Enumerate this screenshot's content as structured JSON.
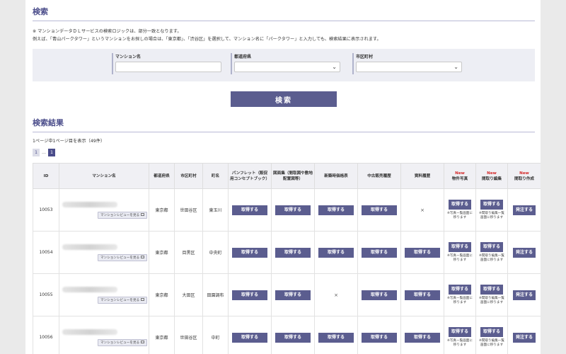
{
  "search": {
    "title": "検索",
    "notes": [
      "※ マンションデータＤＬサービスの検索ロジックは、部分一致となります。",
      "例えば、「青山パークタワー」というマンションをお探しの場合は、「東京都」、「渋谷区」を選択して、マンション名に「パークタワー」と入力しても、検索結果に表示されます。"
    ],
    "fields": {
      "mansion_label": "マンション名",
      "mansion_value": "",
      "pref_label": "都道府県",
      "pref_value": "",
      "city_label": "市区町村",
      "city_value": ""
    },
    "button_label": "検索"
  },
  "results": {
    "title": "検索結果",
    "count_text": "1ページ中1ページ目を表示（49件）",
    "pager": {
      "first": "1",
      "dots": "…",
      "current": "1"
    },
    "new_badge": "New",
    "headers": {
      "id": "ID",
      "name": "マンション名",
      "pref": "都道府県",
      "city": "市区町村",
      "town": "町名",
      "pamphlet": "パンフレット（販促用コンセプトブック）",
      "floorplan": "図面集（間取図や敷地配置図等）",
      "newprice": "新築時価格表",
      "usedsales": "中古販売履歴",
      "history": "資料履歴",
      "photo": "物件写真",
      "layout": "間取り編集",
      "create": "間取り作成"
    },
    "labels": {
      "review": "マンションレビューを見る",
      "get": "取得する",
      "order": "発注する",
      "photo_note": "※写真一覧画面に移ります",
      "layout_note": "※間取り編集一覧画面に移ります",
      "none": "×"
    },
    "rows": [
      {
        "id": "10053",
        "pref": "東京都",
        "city": "世田谷区",
        "town": "東玉川",
        "newprice": true,
        "history": false
      },
      {
        "id": "10054",
        "pref": "東京都",
        "city": "目黒区",
        "town": "中央町",
        "newprice": true,
        "history": true
      },
      {
        "id": "10055",
        "pref": "東京都",
        "city": "大田区",
        "town": "田園調布",
        "newprice": false,
        "history": true
      },
      {
        "id": "10056",
        "pref": "東京都",
        "city": "世田谷区",
        "town": "中町",
        "newprice": true,
        "history": true
      }
    ]
  },
  "colors": {
    "accent": "#5b5d8f",
    "title": "#4a4c8a",
    "new": "#d42b2b"
  }
}
